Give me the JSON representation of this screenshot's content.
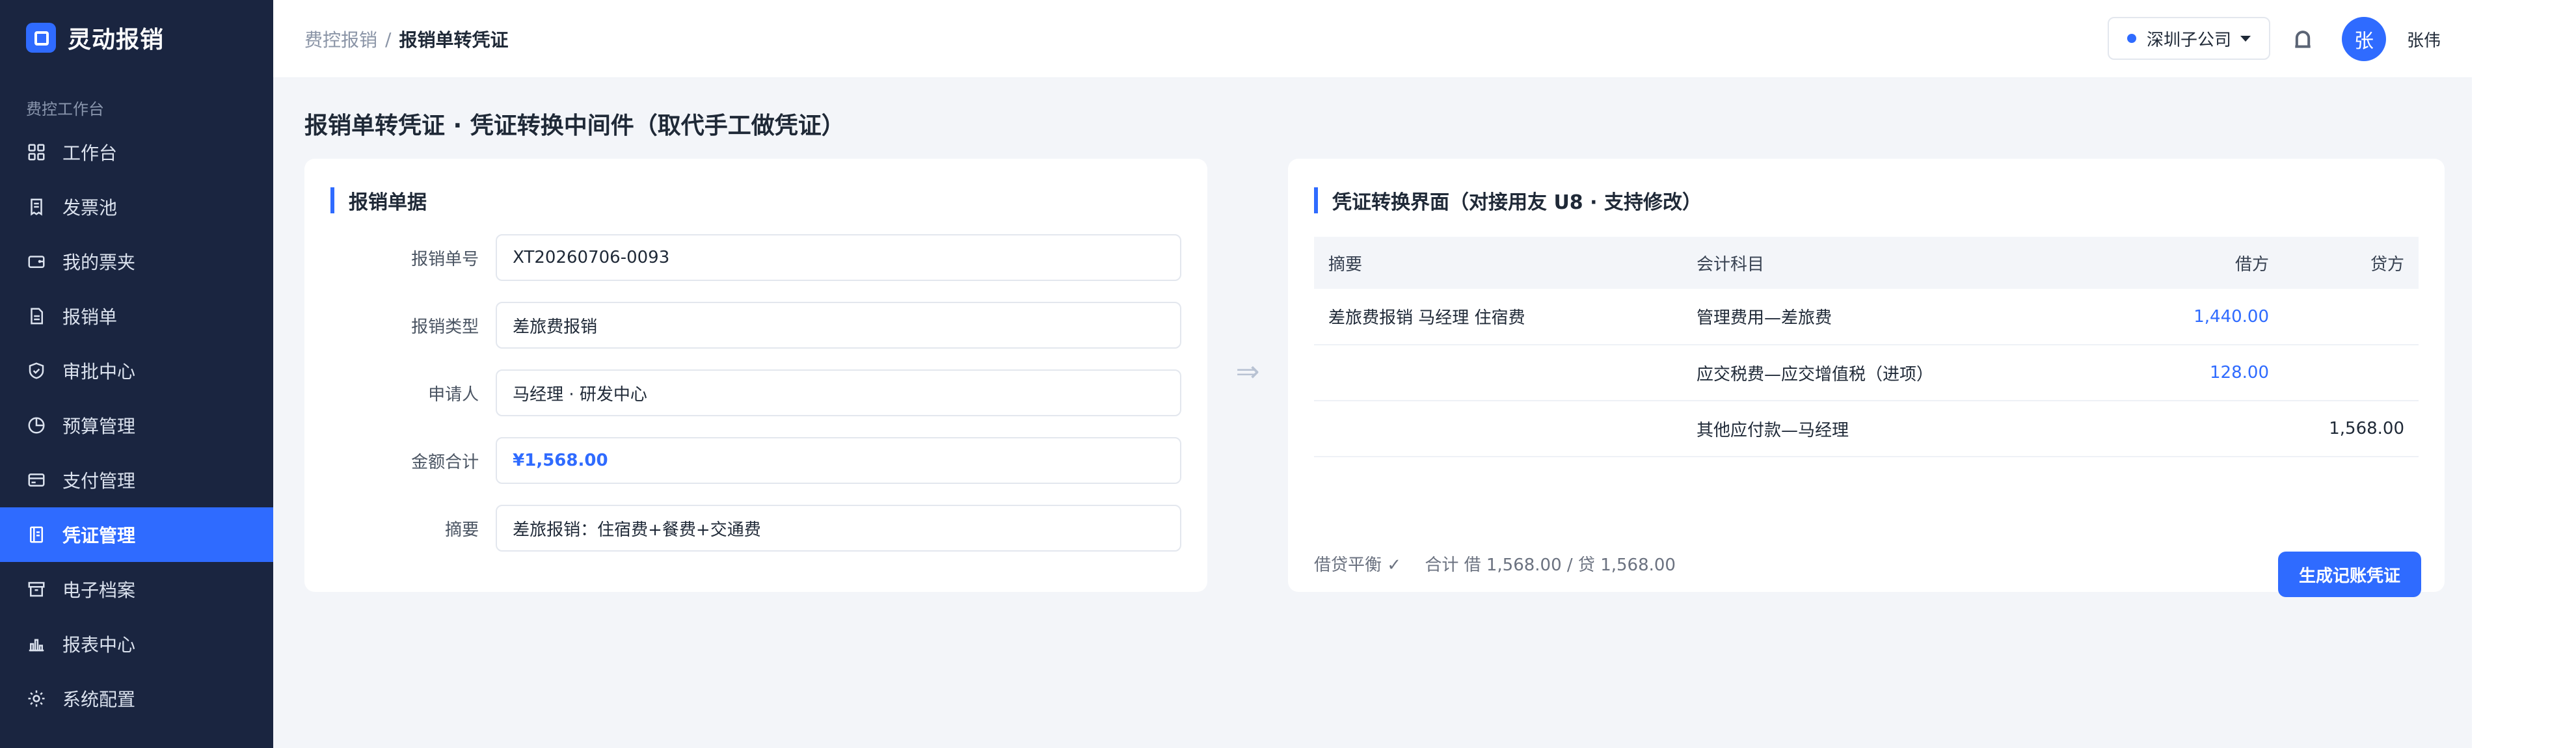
{
  "app": {
    "name": "灵动报销"
  },
  "sidebar": {
    "section": "费控工作台",
    "items": [
      {
        "label": "工作台",
        "icon": "grid-icon"
      },
      {
        "label": "发票池",
        "icon": "invoice-icon"
      },
      {
        "label": "我的票夹",
        "icon": "wallet-icon"
      },
      {
        "label": "报销单",
        "icon": "document-icon"
      },
      {
        "label": "审批中心",
        "icon": "shield-icon"
      },
      {
        "label": "预算管理",
        "icon": "pie-chart-icon"
      },
      {
        "label": "支付管理",
        "icon": "card-icon"
      },
      {
        "label": "凭证管理",
        "icon": "voucher-icon",
        "active": true
      },
      {
        "label": "电子档案",
        "icon": "archive-icon"
      },
      {
        "label": "报表中心",
        "icon": "bar-chart-icon"
      },
      {
        "label": "系统配置",
        "icon": "gear-icon"
      }
    ]
  },
  "header": {
    "breadcrumb_parent": "费控报销",
    "breadcrumb_sep": "/",
    "breadcrumb_current": "报销单转凭证",
    "org": "深圳子公司",
    "avatar": "张",
    "user": "张伟"
  },
  "page": {
    "title": "报销单转凭证 · 凭证转换中间件（取代手工做凭证）"
  },
  "form": {
    "title": "报销单据",
    "fields": [
      {
        "label": "报销单号",
        "value": "XT20260706-0093"
      },
      {
        "label": "报销类型",
        "value": "差旅费报销"
      },
      {
        "label": "申请人",
        "value": "马经理 · 研发中心"
      },
      {
        "label": "金额合计",
        "value": "¥1,568.00"
      },
      {
        "label": "摘要",
        "value": "差旅报销：住宿费+餐费+交通费"
      }
    ]
  },
  "arrow": "⇒",
  "voucher": {
    "title": "凭证转换界面（对接用友 U8 · 支持修改）",
    "columns": [
      "摘要",
      "会计科目",
      "借方",
      "贷方"
    ],
    "rows": [
      {
        "summary": "差旅费报销 马经理 住宿费",
        "account": "管理费用—差旅费",
        "debit": "1,440.00",
        "credit": ""
      },
      {
        "summary": "",
        "account": "应交税费—应交增值税（进项）",
        "debit": "128.00",
        "credit": ""
      },
      {
        "summary": "",
        "account": "其他应付款—马经理",
        "debit": "",
        "credit": "1,568.00"
      }
    ],
    "balance_status": "借贷平衡 ✓",
    "balance_total": "合计 借 1,568.00 / 贷 1,568.00",
    "generate_label": "生成记账凭证"
  }
}
